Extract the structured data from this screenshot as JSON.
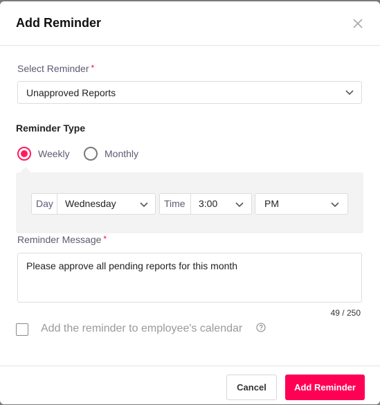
{
  "dialog": {
    "title": "Add Reminder",
    "close_icon": "close-icon"
  },
  "select_reminder": {
    "label": "Select Reminder",
    "required_mark": "*",
    "value": "Unapproved Reports"
  },
  "reminder_type": {
    "title": "Reminder Type",
    "options": [
      {
        "label": "Weekly",
        "checked": true
      },
      {
        "label": "Monthly",
        "checked": false
      }
    ]
  },
  "schedule": {
    "day_label": "Day",
    "day_value": "Wednesday",
    "time_label": "Time",
    "time_value": "3:00",
    "ampm_value": "PM"
  },
  "message": {
    "label": "Reminder Message",
    "required_mark": "*",
    "value": "Please approve all pending reports for this month",
    "counter": "49 / 250"
  },
  "calendar_option": {
    "label": "Add the reminder to employee's calendar",
    "checked": false,
    "help_icon": "help-circle-icon"
  },
  "footer": {
    "cancel_label": "Cancel",
    "submit_label": "Add Reminder"
  },
  "colors": {
    "accent": "#ff0055",
    "radio_selected": "#ff1a5e",
    "label_text": "#5b5b72",
    "panel_bg": "#f3f3f3"
  }
}
